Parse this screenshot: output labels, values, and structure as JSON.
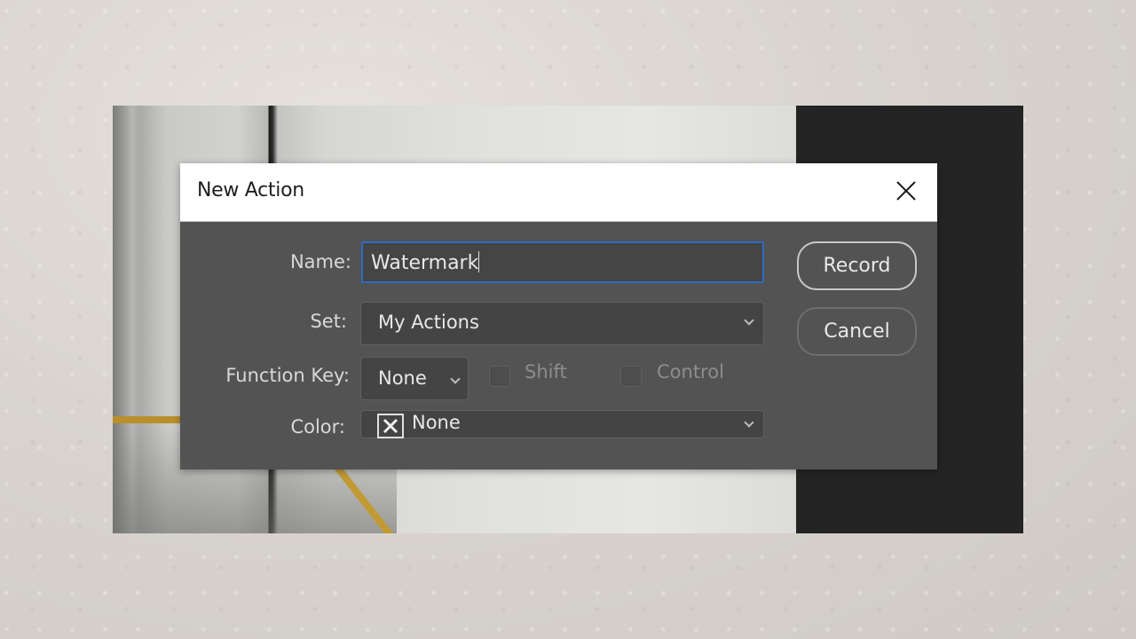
{
  "dialog": {
    "title": "New Action",
    "close_icon": "close-icon",
    "fields": {
      "name": {
        "label": "Name:",
        "value": "Watermark"
      },
      "set": {
        "label": "Set:",
        "value": "My Actions"
      },
      "function_key": {
        "label": "Function Key:",
        "value": "None",
        "shift": {
          "label": "Shift",
          "checked": false,
          "enabled": false
        },
        "control": {
          "label": "Control",
          "checked": false,
          "enabled": false
        }
      },
      "color": {
        "label": "Color:",
        "value": "None",
        "swatch_icon": "x-swatch-icon"
      }
    },
    "buttons": {
      "record": "Record",
      "cancel": "Cancel"
    }
  },
  "colors": {
    "focus_border": "#2c6cc4",
    "dialog_bg": "#535353",
    "titlebar_bg": "#ffffff"
  }
}
